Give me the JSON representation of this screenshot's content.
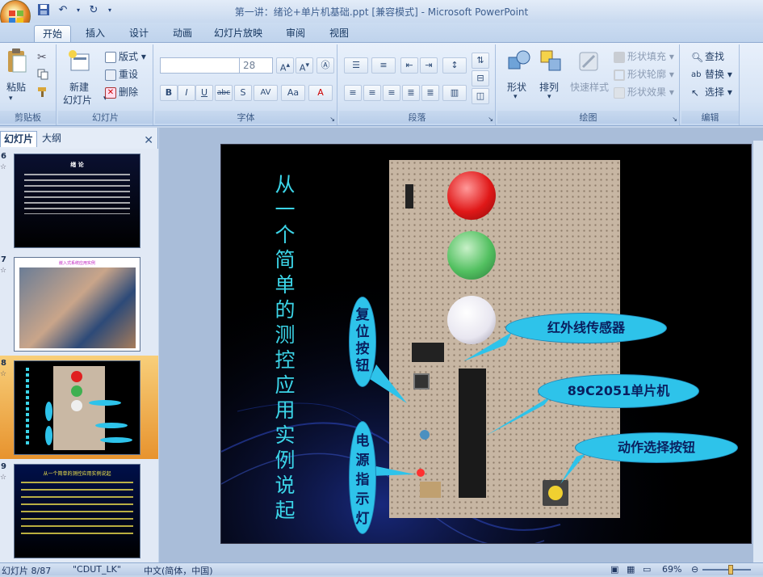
{
  "window": {
    "title": "第一讲：绪论+单片机基础.ppt [兼容模式] - Microsoft PowerPoint"
  },
  "qat": {
    "save_icon": "save-icon",
    "undo_icon": "undo-icon",
    "redo_icon": "redo-icon"
  },
  "tabs": [
    "开始",
    "插入",
    "设计",
    "动画",
    "幻灯片放映",
    "审阅",
    "视图"
  ],
  "ribbon": {
    "clipboard": {
      "paste": "粘贴",
      "label": "剪贴板"
    },
    "slides": {
      "new_slide_1": "新建",
      "new_slide_2": "幻灯片",
      "layout": "版式",
      "reset": "重设",
      "delete": "删除",
      "label": "幻灯片"
    },
    "font": {
      "size": "28",
      "label": "字体",
      "bold": "B",
      "italic": "I",
      "underline": "U",
      "strike": "abc",
      "shadow": "S",
      "spacing": "AV",
      "case": "Aa",
      "color": "A"
    },
    "paragraph": {
      "label": "段落"
    },
    "drawing": {
      "shapes": "形状",
      "arrange": "排列",
      "quick_styles": "快速样式",
      "fill": "形状填充",
      "outline": "形状轮廓",
      "effects": "形状效果",
      "label": "绘图"
    },
    "editing": {
      "find": "查找",
      "replace": "替换",
      "select": "选择",
      "label": "编辑"
    }
  },
  "left_panel": {
    "tab_slides": "幻灯片",
    "tab_outline": "大纲"
  },
  "thumbnails": [
    {
      "num": "6",
      "title": "绪 论",
      "selected": false
    },
    {
      "num": "7",
      "title": "嵌入式系统应用实例",
      "selected": false
    },
    {
      "num": "8",
      "title": "从一个简单的测控应用实例说起",
      "selected": true
    },
    {
      "num": "9",
      "title": "从一个简单的测控应用实例说起",
      "selected": false
    }
  ],
  "slide": {
    "vertical_title": "从一个简单的测控应用实例说起",
    "callouts": {
      "reset": "复位按钮",
      "ir": "红外线传感器",
      "mcu": "89C2051单片机",
      "power": "电源指示灯",
      "action": "动作选择按钮"
    }
  },
  "status": {
    "slide_pos": "幻灯片 8/87",
    "theme": "\"CDUT_LK\"",
    "language": "中文(简体，中国)",
    "zoom": "69%"
  }
}
